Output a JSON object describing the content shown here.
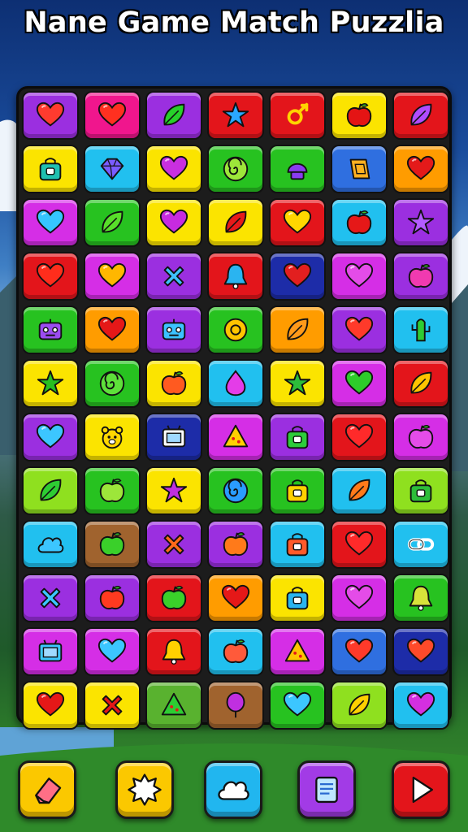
{
  "title": "Nane Game Match Puzzlia",
  "colors": {
    "purple": "#9b2fe0",
    "red": "#e3151b",
    "pink": "#f0168d",
    "yellow": "#fbe400",
    "green": "#27c220",
    "lime": "#8fe01f",
    "cyan": "#21c0ef",
    "orange": "#ff9c00",
    "magenta": "#d52ee6",
    "navy": "#1d2ca8",
    "brown": "#a0632e",
    "olive": "#59b22f",
    "blue": "#2f6fe0"
  },
  "board": {
    "columns": 7,
    "rows": 12,
    "tiles": [
      [
        {
          "bg": "purple",
          "icon": "heart",
          "fg": "#ff3b2f"
        },
        {
          "bg": "pink",
          "icon": "heart",
          "fg": "#ff3020"
        },
        {
          "bg": "purple",
          "icon": "leaf",
          "fg": "#27d02a"
        },
        {
          "bg": "red",
          "icon": "star",
          "fg": "#2aa8ff"
        },
        {
          "bg": "red",
          "icon": "knot",
          "fg": "#ffd400"
        },
        {
          "bg": "yellow",
          "icon": "apple",
          "fg": "#e41414"
        },
        {
          "bg": "red",
          "icon": "leaf",
          "fg": "#b04cff"
        }
      ],
      [
        {
          "bg": "yellow",
          "icon": "bag",
          "fg": "#1fc0b0"
        },
        {
          "bg": "cyan",
          "icon": "gem",
          "fg": "#7a5cff"
        },
        {
          "bg": "yellow",
          "icon": "heart",
          "fg": "#c92fe0"
        },
        {
          "bg": "green",
          "icon": "swirl",
          "fg": "#9de63a"
        },
        {
          "bg": "green",
          "icon": "cap",
          "fg": "#8a3cf0"
        },
        {
          "bg": "blue",
          "icon": "tile",
          "fg": "#ffb020"
        },
        {
          "bg": "orange",
          "icon": "heart",
          "fg": "#e41a1a"
        }
      ],
      [
        {
          "bg": "magenta",
          "icon": "heart",
          "fg": "#35c6ff"
        },
        {
          "bg": "green",
          "icon": "leaf",
          "fg": "#58df2a"
        },
        {
          "bg": "yellow",
          "icon": "heart",
          "fg": "#c72be0"
        },
        {
          "bg": "yellow",
          "icon": "leaf",
          "fg": "#e61a1a"
        },
        {
          "bg": "red",
          "icon": "heart",
          "fg": "#ffd700"
        },
        {
          "bg": "cyan",
          "icon": "apple",
          "fg": "#e51818"
        },
        {
          "bg": "purple",
          "icon": "star",
          "fg": "#b45cff"
        }
      ],
      [
        {
          "bg": "red",
          "icon": "heart",
          "fg": "#ff2d1c"
        },
        {
          "bg": "magenta",
          "icon": "heart",
          "fg": "#ffb700"
        },
        {
          "bg": "purple",
          "icon": "cross",
          "fg": "#3fc0ff"
        },
        {
          "bg": "red",
          "icon": "bell",
          "fg": "#2ab4f0"
        },
        {
          "bg": "navy",
          "icon": "heart",
          "fg": "#e21f1f"
        },
        {
          "bg": "magenta",
          "icon": "heart",
          "fg": "#e44ce8"
        },
        {
          "bg": "purple",
          "icon": "apple",
          "fg": "#f03ab0"
        }
      ],
      [
        {
          "bg": "green",
          "icon": "robot",
          "fg": "#9b4cf0"
        },
        {
          "bg": "orange",
          "icon": "heart",
          "fg": "#e51818"
        },
        {
          "bg": "purple",
          "icon": "robot",
          "fg": "#3cc2ff"
        },
        {
          "bg": "green",
          "icon": "ring",
          "fg": "#ffc400"
        },
        {
          "bg": "orange",
          "icon": "leaf",
          "fg": "#ff9a1a"
        },
        {
          "bg": "purple",
          "icon": "heart",
          "fg": "#ff3a2a"
        },
        {
          "bg": "cyan",
          "icon": "cactus",
          "fg": "#2ecc33"
        }
      ],
      [
        {
          "bg": "yellow",
          "icon": "star",
          "fg": "#27c020"
        },
        {
          "bg": "green",
          "icon": "swirl",
          "fg": "#5ee03a"
        },
        {
          "bg": "yellow",
          "icon": "apple",
          "fg": "#ff5a20"
        },
        {
          "bg": "cyan",
          "icon": "drop",
          "fg": "#e43ce8"
        },
        {
          "bg": "yellow",
          "icon": "star",
          "fg": "#2dbd3a"
        },
        {
          "bg": "magenta",
          "icon": "heart",
          "fg": "#2dcc2a"
        },
        {
          "bg": "red",
          "icon": "leaf",
          "fg": "#ffc400"
        }
      ],
      [
        {
          "bg": "purple",
          "icon": "heart",
          "fg": "#3cc6ff"
        },
        {
          "bg": "yellow",
          "icon": "bear",
          "fg": "#ffd700"
        },
        {
          "bg": "navy",
          "icon": "tv",
          "fg": "#ffffff"
        },
        {
          "bg": "magenta",
          "icon": "cake",
          "fg": "#ffd000"
        },
        {
          "bg": "purple",
          "icon": "bag",
          "fg": "#2dcc3a"
        },
        {
          "bg": "red",
          "icon": "heart",
          "fg": "#ff2a2a"
        },
        {
          "bg": "magenta",
          "icon": "apple",
          "fg": "#e54ce8"
        }
      ],
      [
        {
          "bg": "lime",
          "icon": "leaf",
          "fg": "#2ecc33"
        },
        {
          "bg": "green",
          "icon": "apple",
          "fg": "#9de63a"
        },
        {
          "bg": "yellow",
          "icon": "star",
          "fg": "#c02fe0"
        },
        {
          "bg": "green",
          "icon": "swirl",
          "fg": "#2a9cff"
        },
        {
          "bg": "green",
          "icon": "bag",
          "fg": "#ffd000"
        },
        {
          "bg": "cyan",
          "icon": "leaf",
          "fg": "#ff7a1a"
        },
        {
          "bg": "lime",
          "icon": "bag",
          "fg": "#2dbd3a"
        }
      ],
      [
        {
          "bg": "cyan",
          "icon": "cloud",
          "fg": "#3cc6ff"
        },
        {
          "bg": "brown",
          "icon": "apple",
          "fg": "#3ad02a"
        },
        {
          "bg": "purple",
          "icon": "cross",
          "fg": "#ff6a1a"
        },
        {
          "bg": "purple",
          "icon": "apple",
          "fg": "#ff7a1a"
        },
        {
          "bg": "cyan",
          "icon": "bag",
          "fg": "#ff5a2a"
        },
        {
          "bg": "red",
          "icon": "heart",
          "fg": "#ff2a2a"
        },
        {
          "bg": "cyan",
          "icon": "link",
          "fg": "#ffffff"
        }
      ],
      [
        {
          "bg": "purple",
          "icon": "cross",
          "fg": "#3cc6ff"
        },
        {
          "bg": "purple",
          "icon": "apple",
          "fg": "#ff3a20"
        },
        {
          "bg": "red",
          "icon": "apple",
          "fg": "#3ad02a"
        },
        {
          "bg": "orange",
          "icon": "heart",
          "fg": "#e51818"
        },
        {
          "bg": "yellow",
          "icon": "bag",
          "fg": "#2ab4f0"
        },
        {
          "bg": "magenta",
          "icon": "heart",
          "fg": "#e44ce8"
        },
        {
          "bg": "green",
          "icon": "bell",
          "fg": "#d8e23a"
        }
      ],
      [
        {
          "bg": "magenta",
          "icon": "tv",
          "fg": "#3cc6ff"
        },
        {
          "bg": "magenta",
          "icon": "heart",
          "fg": "#3cc6ff"
        },
        {
          "bg": "red",
          "icon": "bell",
          "fg": "#ffd000"
        },
        {
          "bg": "cyan",
          "icon": "apple",
          "fg": "#ff5a3a"
        },
        {
          "bg": "magenta",
          "icon": "cake",
          "fg": "#ffc400"
        },
        {
          "bg": "blue",
          "icon": "heart",
          "fg": "#ff3a2a"
        },
        {
          "bg": "navy",
          "icon": "heart",
          "fg": "#ff4a2a"
        }
      ],
      [
        {
          "bg": "yellow",
          "icon": "heart",
          "fg": "#e51818"
        },
        {
          "bg": "yellow",
          "icon": "cross",
          "fg": "#e51818"
        },
        {
          "bg": "olive",
          "icon": "cake",
          "fg": "#2dcc33"
        },
        {
          "bg": "brown",
          "icon": "balloon",
          "fg": "#c02fe0"
        },
        {
          "bg": "green",
          "icon": "heart",
          "fg": "#3cc6ff"
        },
        {
          "bg": "lime",
          "icon": "leaf",
          "fg": "#ffd000"
        },
        {
          "bg": "cyan",
          "icon": "heart",
          "fg": "#d42fe0"
        }
      ]
    ]
  },
  "toolbar": [
    {
      "name": "eraser",
      "bg": "#fbc800",
      "icon": "eraser",
      "fg": "#ff6f86"
    },
    {
      "name": "bomb",
      "bg": "#fbc800",
      "icon": "burst",
      "fg": "#ffffff"
    },
    {
      "name": "shuffle",
      "bg": "#21b6ef",
      "icon": "cloud",
      "fg": "#ffffff"
    },
    {
      "name": "hint",
      "bg": "#a23be6",
      "icon": "scroll",
      "fg": "#bfe6ff"
    },
    {
      "name": "play",
      "bg": "#e3151b",
      "icon": "play",
      "fg": "#ffffff"
    }
  ]
}
